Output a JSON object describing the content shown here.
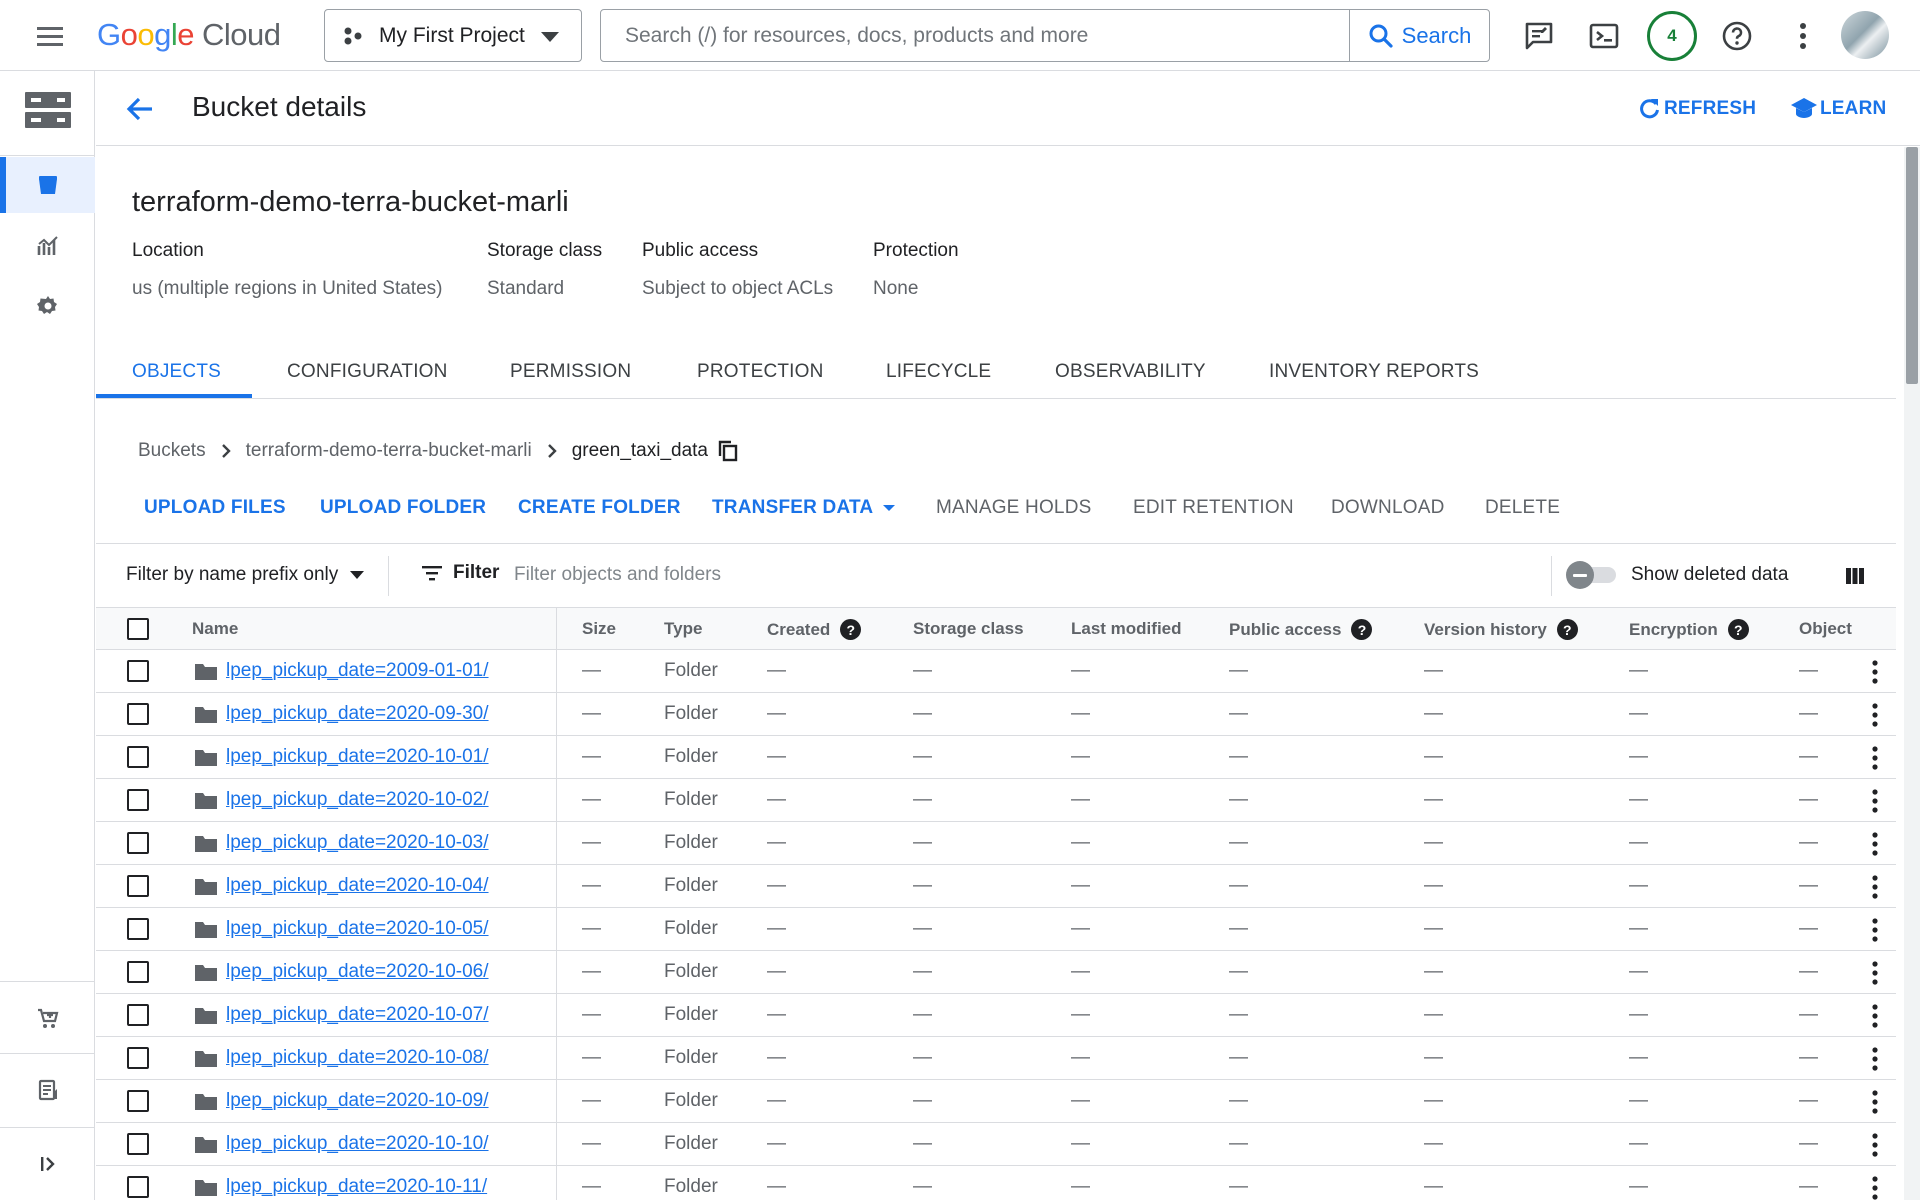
{
  "topbar": {
    "logo_word": [
      "G",
      "o",
      "o",
      "g",
      "l",
      "e"
    ],
    "logo_product": "Cloud",
    "project_name": "My First Project",
    "search_placeholder": "Search (/) for resources, docs, products and more",
    "search_button": "Search",
    "notifications_count": "4",
    "icons": [
      "menu-icon",
      "project-icon",
      "search-icon",
      "feedback-icon",
      "cloud-shell-icon",
      "help-icon",
      "more-vert-icon",
      "account-avatar"
    ]
  },
  "rail": {
    "icons": [
      "storage-product-icon",
      "bucket-icon",
      "monitoring-icon",
      "settings-icon",
      "marketplace-icon",
      "release-notes-icon",
      "expand-rail-icon"
    ]
  },
  "header": {
    "title": "Bucket details",
    "refresh_label": "REFRESH",
    "learn_label": "LEARN"
  },
  "bucket": {
    "name": "terraform-demo-terra-bucket-marli",
    "meta": [
      {
        "label": "Location",
        "value": "us (multiple regions in United States)"
      },
      {
        "label": "Storage class",
        "value": "Standard"
      },
      {
        "label": "Public access",
        "value": "Subject to object ACLs"
      },
      {
        "label": "Protection",
        "value": "None"
      }
    ]
  },
  "tabs": [
    "OBJECTS",
    "CONFIGURATION",
    "PERMISSION",
    "PROTECTION",
    "LIFECYCLE",
    "OBSERVABILITY",
    "INVENTORY REPORTS"
  ],
  "breadcrumb": [
    "Buckets",
    "terraform-demo-terra-bucket-marli",
    "green_taxi_data"
  ],
  "actions": [
    "UPLOAD FILES",
    "UPLOAD FOLDER",
    "CREATE FOLDER",
    "TRANSFER DATA",
    "MANAGE HOLDS",
    "EDIT RETENTION",
    "DOWNLOAD",
    "DELETE"
  ],
  "filterbar": {
    "prefix_label": "Filter by name prefix only",
    "filter_label": "Filter",
    "filter_placeholder": "Filter objects and folders",
    "show_deleted_label": "Show deleted data",
    "show_deleted_on": false
  },
  "table": {
    "columns": [
      "Name",
      "Size",
      "Type",
      "Created",
      "Storage class",
      "Last modified",
      "Public access",
      "Version history",
      "Encryption",
      "Object r"
    ],
    "rows": [
      {
        "name": "lpep_pickup_date=2009-01-01/",
        "size": "—",
        "type": "Folder",
        "created": "—",
        "storage_class": "—",
        "last_modified": "—",
        "public_access": "—",
        "version_history": "—",
        "encryption": "—",
        "object_r": "—"
      },
      {
        "name": "lpep_pickup_date=2020-09-30/",
        "size": "—",
        "type": "Folder",
        "created": "—",
        "storage_class": "—",
        "last_modified": "—",
        "public_access": "—",
        "version_history": "—",
        "encryption": "—",
        "object_r": "—"
      },
      {
        "name": "lpep_pickup_date=2020-10-01/",
        "size": "—",
        "type": "Folder",
        "created": "—",
        "storage_class": "—",
        "last_modified": "—",
        "public_access": "—",
        "version_history": "—",
        "encryption": "—",
        "object_r": "—"
      },
      {
        "name": "lpep_pickup_date=2020-10-02/",
        "size": "—",
        "type": "Folder",
        "created": "—",
        "storage_class": "—",
        "last_modified": "—",
        "public_access": "—",
        "version_history": "—",
        "encryption": "—",
        "object_r": "—"
      },
      {
        "name": "lpep_pickup_date=2020-10-03/",
        "size": "—",
        "type": "Folder",
        "created": "—",
        "storage_class": "—",
        "last_modified": "—",
        "public_access": "—",
        "version_history": "—",
        "encryption": "—",
        "object_r": "—"
      },
      {
        "name": "lpep_pickup_date=2020-10-04/",
        "size": "—",
        "type": "Folder",
        "created": "—",
        "storage_class": "—",
        "last_modified": "—",
        "public_access": "—",
        "version_history": "—",
        "encryption": "—",
        "object_r": "—"
      },
      {
        "name": "lpep_pickup_date=2020-10-05/",
        "size": "—",
        "type": "Folder",
        "created": "—",
        "storage_class": "—",
        "last_modified": "—",
        "public_access": "—",
        "version_history": "—",
        "encryption": "—",
        "object_r": "—"
      },
      {
        "name": "lpep_pickup_date=2020-10-06/",
        "size": "—",
        "type": "Folder",
        "created": "—",
        "storage_class": "—",
        "last_modified": "—",
        "public_access": "—",
        "version_history": "—",
        "encryption": "—",
        "object_r": "—"
      },
      {
        "name": "lpep_pickup_date=2020-10-07/",
        "size": "—",
        "type": "Folder",
        "created": "—",
        "storage_class": "—",
        "last_modified": "—",
        "public_access": "—",
        "version_history": "—",
        "encryption": "—",
        "object_r": "—"
      },
      {
        "name": "lpep_pickup_date=2020-10-08/",
        "size": "—",
        "type": "Folder",
        "created": "—",
        "storage_class": "—",
        "last_modified": "—",
        "public_access": "—",
        "version_history": "—",
        "encryption": "—",
        "object_r": "—"
      },
      {
        "name": "lpep_pickup_date=2020-10-09/",
        "size": "—",
        "type": "Folder",
        "created": "—",
        "storage_class": "—",
        "last_modified": "—",
        "public_access": "—",
        "version_history": "—",
        "encryption": "—",
        "object_r": "—"
      },
      {
        "name": "lpep_pickup_date=2020-10-10/",
        "size": "—",
        "type": "Folder",
        "created": "—",
        "storage_class": "—",
        "last_modified": "—",
        "public_access": "—",
        "version_history": "—",
        "encryption": "—",
        "object_r": "—"
      },
      {
        "name": "lpep_pickup_date=2020-10-11/",
        "size": "—",
        "type": "Folder",
        "created": "—",
        "storage_class": "—",
        "last_modified": "—",
        "public_access": "—",
        "version_history": "—",
        "encryption": "—",
        "object_r": "—"
      }
    ]
  },
  "colors": {
    "accent": "#1a73e8",
    "badge": "#188038",
    "border": "#dadce0",
    "muted_text": "#5f6368"
  }
}
